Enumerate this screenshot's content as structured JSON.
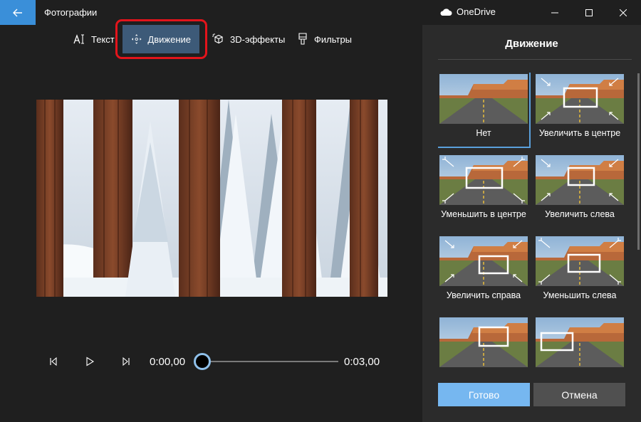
{
  "window": {
    "app_title": "Фотографии",
    "onedrive_label": "OneDrive",
    "controls": [
      "minimize-icon",
      "maximize-icon",
      "close-icon"
    ]
  },
  "toolbar": {
    "items": [
      {
        "label": "Текст",
        "icon": "text-icon"
      },
      {
        "label": "Движение",
        "icon": "motion-icon",
        "active": true
      },
      {
        "label": "3D-эффекты",
        "icon": "effects-3d-icon"
      },
      {
        "label": "Фильтры",
        "icon": "filters-icon"
      }
    ]
  },
  "playback": {
    "current_time": "0:00,00",
    "end_time": "0:03,00",
    "progress": 0
  },
  "panel": {
    "title": "Движение",
    "options": [
      {
        "label": "Нет",
        "selected": true,
        "motion": "none"
      },
      {
        "label": "Увеличить в центре",
        "motion": "zoom-in-center"
      },
      {
        "label": "Уменьшить в центре",
        "motion": "zoom-out-center"
      },
      {
        "label": "Увеличить слева",
        "motion": "zoom-in-left"
      },
      {
        "label": "Увеличить справа",
        "motion": "zoom-in-right"
      },
      {
        "label": "Уменьшить слева",
        "motion": "zoom-out-left"
      },
      {
        "label": "",
        "motion": "pan-center"
      },
      {
        "label": "",
        "motion": "pan-left"
      }
    ],
    "done_label": "Готово",
    "cancel_label": "Отмена"
  },
  "colors": {
    "accent": "#3a8fd9",
    "active_tool": "#3d5a78",
    "highlight": "#e3141b",
    "done_button": "#76b7f0"
  }
}
